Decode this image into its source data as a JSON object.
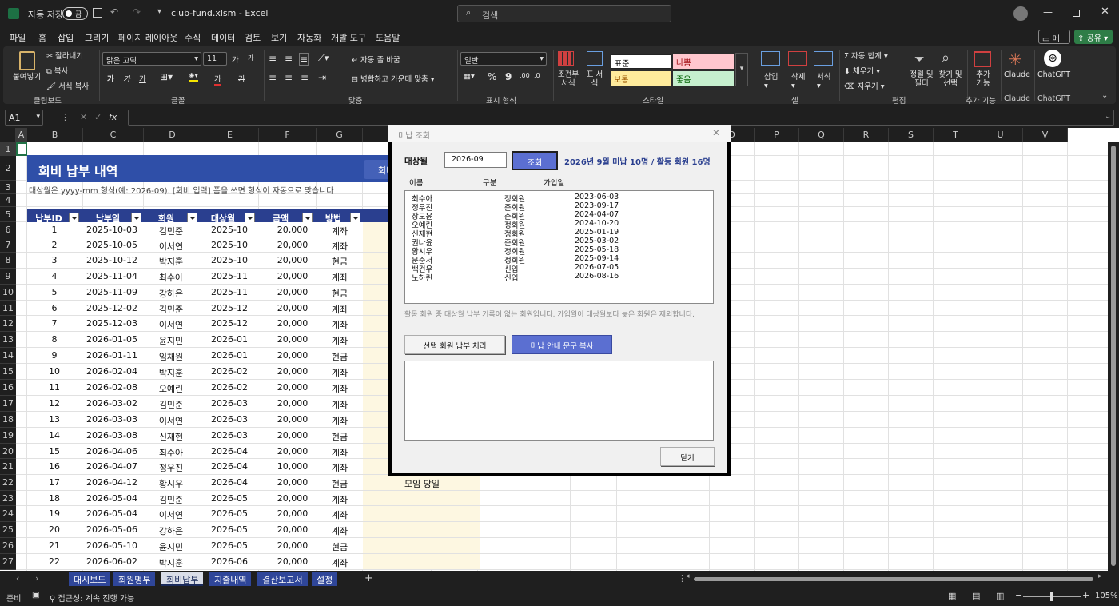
{
  "titlebar": {
    "autosave_label": "자동 저장",
    "toggle_state": "끔",
    "filename": "club-fund.xlsm",
    "dash": "-",
    "app": "Excel",
    "search_placeholder": "검색"
  },
  "menu": [
    "파일",
    "홈",
    "삽입",
    "그리기",
    "페이지 레이아웃",
    "수식",
    "데이터",
    "검토",
    "보기",
    "자동화",
    "개발 도구",
    "도움말"
  ],
  "menu_right": {
    "memo": "메모",
    "share": "공유"
  },
  "ribbon": {
    "clipboard": {
      "paste": "붙여넣기",
      "cut": "잘라내기",
      "copy": "복사",
      "format_painter": "서식 복사",
      "group": "클립보드"
    },
    "font": {
      "font_name": "맑은 고딕",
      "font_size": "11",
      "grow": "가",
      "shrink": "가",
      "bold": "가",
      "italic": "가",
      "underline": "가",
      "strike": "가",
      "font_color": "가",
      "group": "글꼴"
    },
    "align": {
      "wrap": "자동 줄 바꿈",
      "merge": "병합하고 가운데 맞춤",
      "group": "맞춤"
    },
    "number": {
      "format": "일반",
      "group": "표시 형식",
      "percent": "%",
      "comma": "9"
    },
    "styles": {
      "conditional": "조건부 서식",
      "table": "표 서식",
      "normal": "표준",
      "bad": "나쁨",
      "neutral": "보통",
      "good": "좋음",
      "group": "스타일"
    },
    "cells": {
      "insert": "삽입",
      "delete": "삭제",
      "format": "서식",
      "group": "셀"
    },
    "editing": {
      "autosum": "자동 합계",
      "fill": "채우기",
      "clear": "지우기",
      "sort": "정렬 및 필터",
      "find": "찾기 및 선택",
      "group": "편집"
    },
    "addins": {
      "label": "추가 기능",
      "group": "추가 기능"
    },
    "claude": {
      "label": "Claude",
      "group": "Claude"
    },
    "chatgpt": {
      "label": "ChatGPT",
      "group": "ChatGPT"
    }
  },
  "formula": {
    "namebox": "A1",
    "fx": "fx",
    "content": ""
  },
  "columns": [
    "A",
    "B",
    "C",
    "D",
    "E",
    "F",
    "G",
    "H",
    "I",
    "J",
    "K",
    "L",
    "M",
    "N",
    "O",
    "P",
    "Q",
    "R",
    "S",
    "T",
    "U",
    "V"
  ],
  "rows": [
    "1",
    "2",
    "3",
    "4",
    "5",
    "6",
    "7",
    "8",
    "9",
    "10",
    "11",
    "12",
    "13",
    "14",
    "15",
    "16",
    "17",
    "18",
    "19",
    "20",
    "21",
    "22",
    "23",
    "24",
    "25",
    "26",
    "27"
  ],
  "sheet": {
    "title": "회비 납부 내역",
    "title_button": "회비",
    "subtitle": "대상월은 yyyy-mm 형식(예: 2026-09). [회비 입력] 폼을 쓰면 형식이 자동으로 맞습니다",
    "headers": [
      "납부ID",
      "납부일",
      "회원",
      "대상월",
      "금액",
      "방법"
    ],
    "rows": [
      [
        "1",
        "2025-10-03",
        "김민준",
        "2025-10",
        "20,000",
        "계좌",
        ""
      ],
      [
        "2",
        "2025-10-05",
        "이서연",
        "2025-10",
        "20,000",
        "계좌",
        ""
      ],
      [
        "3",
        "2025-10-12",
        "박지훈",
        "2025-10",
        "20,000",
        "현금",
        ""
      ],
      [
        "4",
        "2025-11-04",
        "최수아",
        "2025-11",
        "20,000",
        "계좌",
        ""
      ],
      [
        "5",
        "2025-11-09",
        "강하은",
        "2025-11",
        "20,000",
        "현금",
        ""
      ],
      [
        "6",
        "2025-12-02",
        "김민준",
        "2025-12",
        "20,000",
        "계좌",
        ""
      ],
      [
        "7",
        "2025-12-03",
        "이서연",
        "2025-12",
        "20,000",
        "계좌",
        ""
      ],
      [
        "8",
        "2026-01-05",
        "윤지민",
        "2026-01",
        "20,000",
        "계좌",
        ""
      ],
      [
        "9",
        "2026-01-11",
        "임채원",
        "2026-01",
        "20,000",
        "현금",
        ""
      ],
      [
        "10",
        "2026-02-04",
        "박지훈",
        "2026-02",
        "20,000",
        "계좌",
        ""
      ],
      [
        "11",
        "2026-02-08",
        "오예린",
        "2026-02",
        "20,000",
        "계좌",
        ""
      ],
      [
        "12",
        "2026-03-02",
        "김민준",
        "2026-03",
        "20,000",
        "계좌",
        ""
      ],
      [
        "13",
        "2026-03-03",
        "이서연",
        "2026-03",
        "20,000",
        "계좌",
        ""
      ],
      [
        "14",
        "2026-03-08",
        "신재현",
        "2026-03",
        "20,000",
        "현금",
        ""
      ],
      [
        "15",
        "2026-04-06",
        "최수아",
        "2026-04",
        "20,000",
        "계좌",
        ""
      ],
      [
        "16",
        "2026-04-07",
        "정우진",
        "2026-04",
        "10,000",
        "계좌",
        ""
      ],
      [
        "17",
        "2026-04-12",
        "황시우",
        "2026-04",
        "20,000",
        "현금",
        "모임 당일"
      ],
      [
        "18",
        "2026-05-04",
        "김민준",
        "2026-05",
        "20,000",
        "계좌",
        ""
      ],
      [
        "19",
        "2026-05-04",
        "이서연",
        "2026-05",
        "20,000",
        "계좌",
        ""
      ],
      [
        "20",
        "2026-05-06",
        "강하은",
        "2026-05",
        "20,000",
        "계좌",
        ""
      ],
      [
        "21",
        "2026-05-10",
        "윤지민",
        "2026-05",
        "20,000",
        "현금",
        ""
      ],
      [
        "22",
        "2026-06-02",
        "박지훈",
        "2026-06",
        "20,000",
        "계좌",
        ""
      ]
    ]
  },
  "dialog": {
    "title": "미납 조회",
    "target_label": "대상월",
    "target_value": "2026-09",
    "search_button": "조회",
    "summary": "2026년 9월 미납 10명 / 활동 회원 16명",
    "list_headers": [
      "이름",
      "구분",
      "가입일"
    ],
    "list_rows": [
      [
        "최수아",
        "정회원",
        "2023-06-03"
      ],
      [
        "정우진",
        "준회원",
        "2023-09-17"
      ],
      [
        "장도윤",
        "준회원",
        "2024-04-07"
      ],
      [
        "오예린",
        "정회원",
        "2024-10-20"
      ],
      [
        "신재현",
        "정회원",
        "2025-01-19"
      ],
      [
        "권나윤",
        "준회원",
        "2025-03-02"
      ],
      [
        "황시우",
        "정회원",
        "2025-05-18"
      ],
      [
        "문준서",
        "정회원",
        "2025-09-14"
      ],
      [
        "백건우",
        "신입",
        "2026-07-05"
      ],
      [
        "노하린",
        "신입",
        "2026-08-16"
      ]
    ],
    "note": "활동 회원 중 대상월 납부 기록이 없는 회원입니다. 가입월이 대상월보다 늦은 회원은 제외합니다.",
    "process_button": "선택 회원 납부 처리",
    "copy_button": "미납 안내 문구 복사",
    "message": "",
    "close_button": "닫기"
  },
  "tabs": [
    "대시보드",
    "회원명부",
    "회비납부",
    "지출내역",
    "결산보고서",
    "설정"
  ],
  "tabs_active": "회비납부",
  "status": {
    "ready": "준비",
    "accessibility": "접근성: 계속 진행 가능",
    "zoom": "105%"
  }
}
